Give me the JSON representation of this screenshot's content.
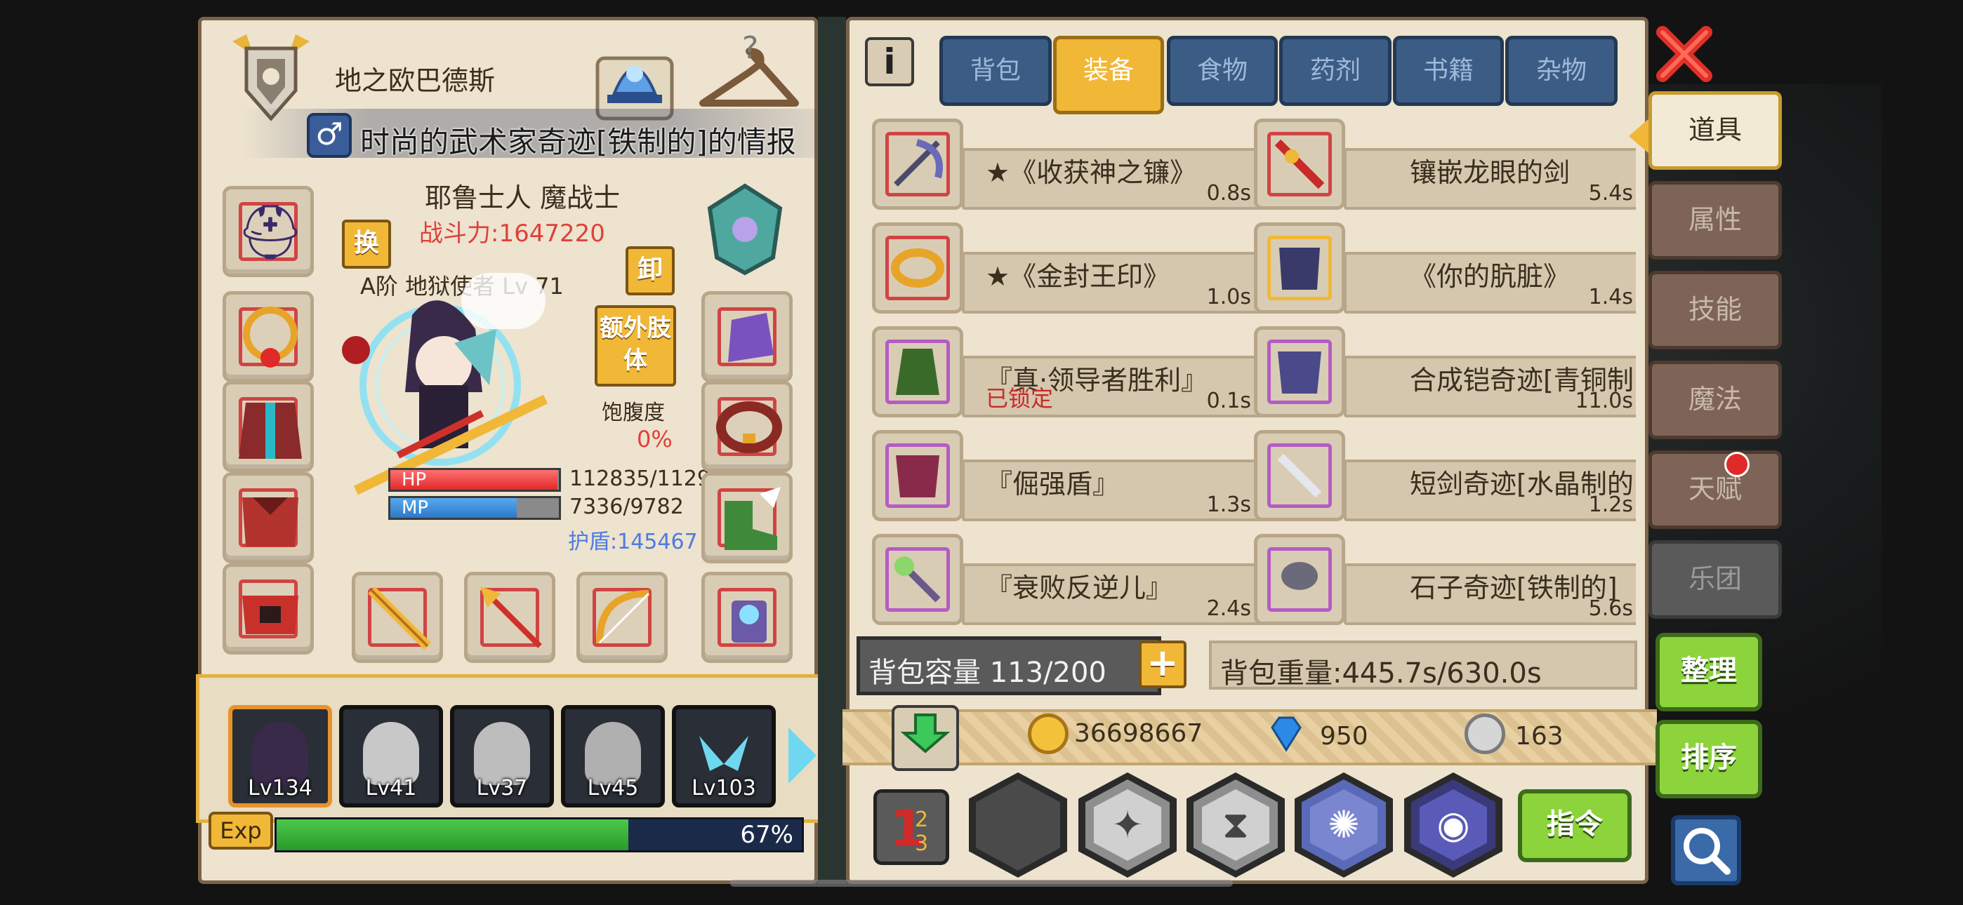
{
  "character": {
    "name": "地之欧巴德斯",
    "item_info_title": "时尚的武术家奇迹[铁制的]的情报",
    "class": "耶鲁士人 魔战士",
    "combat_power": "战斗力:1647220",
    "swap_label": "换",
    "unequip_label": "卸",
    "weapon_line": "A阶 地狱使者 Lv 71",
    "extra_limbs_label": "额外肢体",
    "hunger_label": "饱腹度",
    "hunger_value": "0%",
    "hp_label": "HP",
    "hp_value": "112835/1129",
    "hp_fraction": 0.99,
    "mp_label": "MP",
    "mp_value": "7336/9782",
    "mp_fraction": 0.75,
    "shield": "护盾:145467",
    "exp_label": "Exp",
    "exp_percent": "67%",
    "exp_fraction": 0.67
  },
  "party": [
    {
      "level": "Lv134",
      "selected": true
    },
    {
      "level": "Lv41",
      "selected": false
    },
    {
      "level": "Lv37",
      "selected": false
    },
    {
      "level": "Lv45",
      "selected": false
    },
    {
      "level": "Lv103",
      "selected": false
    }
  ],
  "inventory": {
    "tabs": [
      "背包",
      "装备",
      "食物",
      "药剂",
      "书籍",
      "杂物"
    ],
    "active_tab": "装备",
    "items": [
      {
        "name": "★《收获神之镰》",
        "weight": "0.8s",
        "frame": "#d04444"
      },
      {
        "name": "镶嵌龙眼的剑",
        "weight": "5.4s",
        "frame": "#d04444"
      },
      {
        "name": "★《金封王印》",
        "weight": "1.0s",
        "frame": "#d04444"
      },
      {
        "name": "《你的肮脏》",
        "weight": "1.4s",
        "frame": "#f1b736"
      },
      {
        "name": "『真·领导者胜利』",
        "weight": "0.1s",
        "locked": "已锁定",
        "frame": "#b45cc4"
      },
      {
        "name": "合成铠奇迹[青铜制",
        "weight": "11.0s",
        "frame": "#b45cc4"
      },
      {
        "name": "『倔强盾』",
        "weight": "1.3s",
        "frame": "#b45cc4"
      },
      {
        "name": "短剑奇迹[水晶制的]",
        "weight": "1.2s",
        "frame": "#b45cc4"
      },
      {
        "name": "『衰败反逆儿』",
        "weight": "2.4s",
        "frame": "#b45cc4"
      },
      {
        "name": "石子奇迹[铁制的]",
        "weight": "5.6s",
        "frame": "#b45cc4"
      }
    ],
    "capacity": "背包容量 113/200",
    "weight": "背包重量:445.7s/630.0s",
    "gold": "36698667",
    "diamonds": "950",
    "silver": "163",
    "command_label": "指令"
  },
  "side_tabs": [
    {
      "label": "道具",
      "active": true
    },
    {
      "label": "属性",
      "active": false
    },
    {
      "label": "技能",
      "active": false
    },
    {
      "label": "魔法",
      "active": false
    },
    {
      "label": "天赋",
      "active": false,
      "badge": true
    },
    {
      "label": "乐团",
      "active": false
    }
  ],
  "actions": {
    "organize": "整理",
    "sort": "排序"
  },
  "colors": {
    "panel_bg": "#ede3cf",
    "tab_blue": "#3b5c85",
    "tab_active": "#f1b736",
    "green_button": "#8cd33c",
    "combat_red": "#e0403a",
    "shield_blue": "#4d7be0"
  }
}
